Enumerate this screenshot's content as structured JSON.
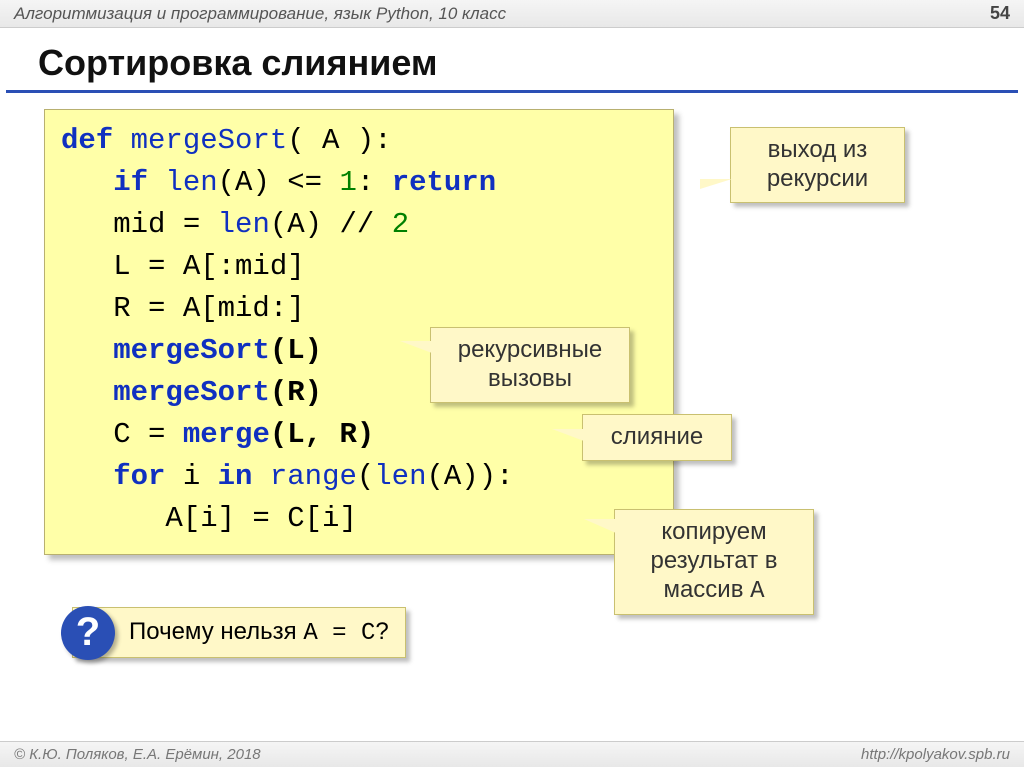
{
  "header": {
    "subject": "Алгоритмизация и программирование, язык Python, 10 класс",
    "page_number": "54"
  },
  "title": "Сортировка слиянием",
  "code": {
    "l1a": "def",
    "l1b": " mergeSort",
    "l1c": "( A ):",
    "l2a": "   if",
    "l2b": " len",
    "l2c": "(A) <= ",
    "l2d": "1",
    "l2e": ": ",
    "l2f": "return",
    "l3a": "   mid = ",
    "l3b": "len",
    "l3c": "(A) // ",
    "l3d": "2",
    "l4": "   L = A[:mid]",
    "l5": "   R = A[mid:]",
    "l6a": "   ",
    "l6b": "mergeSort",
    "l6c": "(L)",
    "l7a": "   ",
    "l7b": "mergeSort",
    "l7c": "(R)",
    "l8a": "   C = ",
    "l8b": "merge",
    "l8c": "(L, R)",
    "l9a": "   for",
    "l9b": " i ",
    "l9c": "in",
    "l9d": " range",
    "l9e": "(",
    "l9f": "len",
    "l9g": "(A)):",
    "l10": "      A[i] = C[i]"
  },
  "callouts": {
    "exit_recursion": "выход из\nрекурсии",
    "recursive_calls": "рекурсивные\nвызовы",
    "merge": "слияние",
    "copy_result_a": "копируем\nрезультат в\n",
    "copy_result_b": "массив ",
    "copy_result_c": "A"
  },
  "question": {
    "mark": "?",
    "text_a": "Почему нельзя ",
    "text_b": "A = C",
    "text_c": "?"
  },
  "footer": {
    "left": "© К.Ю. Поляков, Е.А. Ерёмин, 2018",
    "right": "http://kpolyakov.spb.ru"
  }
}
